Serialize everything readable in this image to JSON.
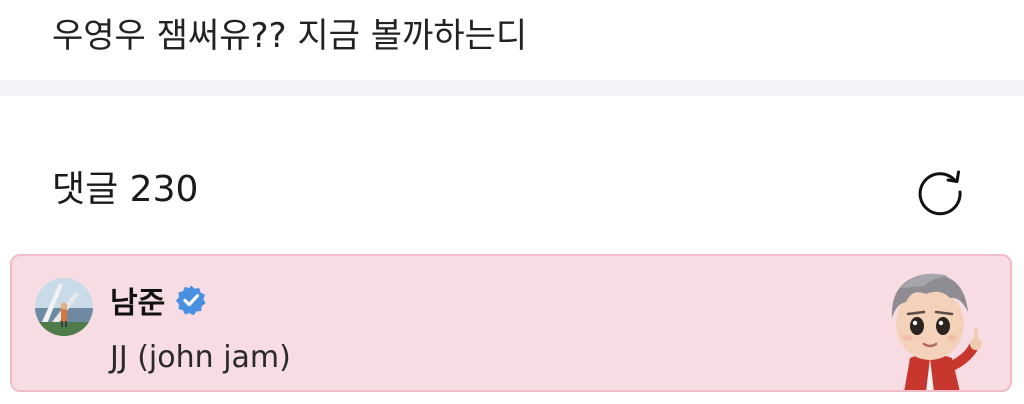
{
  "post": {
    "text": "우영우 잼써유?? 지금 볼까하는디"
  },
  "comments_section": {
    "header": "댓글 230",
    "refresh_icon": "refresh-icon"
  },
  "comment": {
    "author": "남준",
    "verified_icon": "verified-badge-icon",
    "text": "JJ (john jam)",
    "card_background": "#f7dde3",
    "card_border": "#efbcc8",
    "verified_color": "#4a90e2"
  }
}
